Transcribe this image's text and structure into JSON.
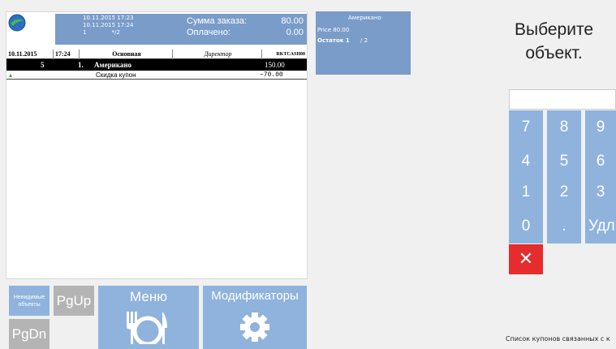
{
  "order_header": {
    "info_lines": [
      "10.11.2015 17:23",
      "10.11.2015 17:24",
      "1              */2"
    ],
    "sum_label": "Сумма заказа:",
    "sum_value": "80.00",
    "paid_label": "Оплачено:",
    "paid_value": "0.00"
  },
  "order_table": {
    "date": "10.11.2015",
    "time": "17:24",
    "hall": "Основная",
    "waiter": "Директор",
    "terminal": "RKTCASH00",
    "item": {
      "qty": "5",
      "index": "1.",
      "name": "Американо",
      "price": "150.00"
    },
    "discount": {
      "name": "Скидка купон",
      "amount": "−70.00"
    }
  },
  "item_tile": {
    "name": "Американо",
    "price": "Price 80.00",
    "rest_label": "Остаток 1",
    "rest_total": "/ 2"
  },
  "prompt": {
    "line1": "Выберите",
    "line2": "объект."
  },
  "keypad": [
    "7",
    "8",
    "9",
    "4",
    "5",
    "6",
    "1",
    "2",
    "3",
    "0",
    ".",
    "Удл"
  ],
  "cancel_icon": "✕",
  "bottom": {
    "hidden_objects": "Невидимые объекты",
    "pgup": "PgUp",
    "pgdn": "PgDn",
    "menu": "Меню",
    "modifiers": "Модификаторы"
  },
  "coupon_note": "Список купонов связанных с к",
  "colors": {
    "tile_blue": "#7a9cc9",
    "key_blue": "#8fb3dc",
    "cancel_red": "#e62c2c",
    "gray": "#b4b4b4"
  }
}
